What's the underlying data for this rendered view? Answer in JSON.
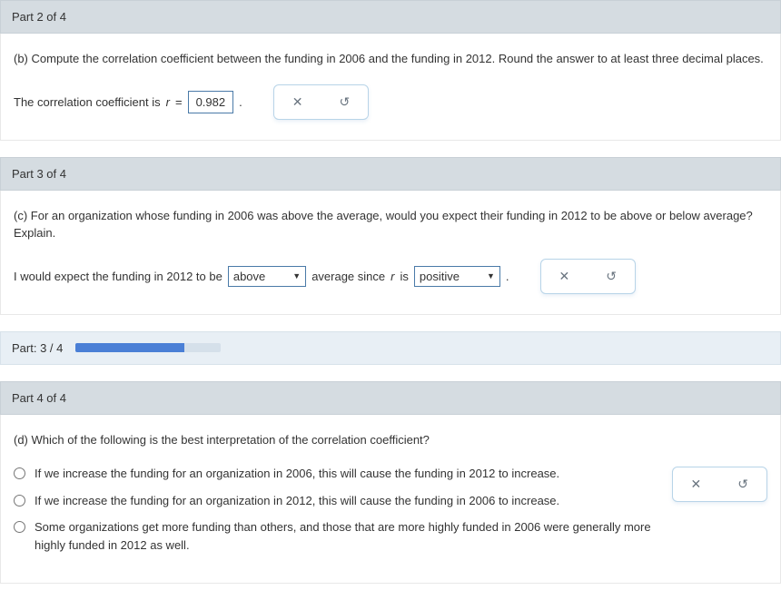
{
  "part2": {
    "header": "Part 2 of 4",
    "question": "(b) Compute the correlation coefficient between the funding in 2006 and the funding in 2012. Round the answer to at least three decimal places.",
    "answer_prefix": "The correlation coefficient is ",
    "r_symbol": "r",
    "equals": " = ",
    "value": "0.982",
    "period": "."
  },
  "part3": {
    "header": "Part 3 of 4",
    "question": "(c) For an organization whose funding in 2006 was above the average, would you expect their funding in 2012 to be above or below average? Explain.",
    "answer_prefix": "I would expect the funding in 2012 to be ",
    "select1": "above",
    "mid_text": " average since ",
    "r_symbol": "r",
    "is_text": " is ",
    "select2": "positive",
    "period": "."
  },
  "progress": {
    "label": "Part: 3 / 4"
  },
  "part4": {
    "header": "Part 4 of 4",
    "question": "(d) Which of the following is the best interpretation of the correlation coefficient?",
    "options": [
      "If we increase the funding for an organization in 2006, this will cause the funding in 2012 to increase.",
      "If we increase the funding for an organization in 2012, this will cause the funding in 2006 to increase.",
      "Some organizations get more funding than others, and those that are more highly funded in 2006 were generally more highly funded in 2012 as well."
    ]
  },
  "icons": {
    "close": "✕",
    "reset": "↺"
  }
}
